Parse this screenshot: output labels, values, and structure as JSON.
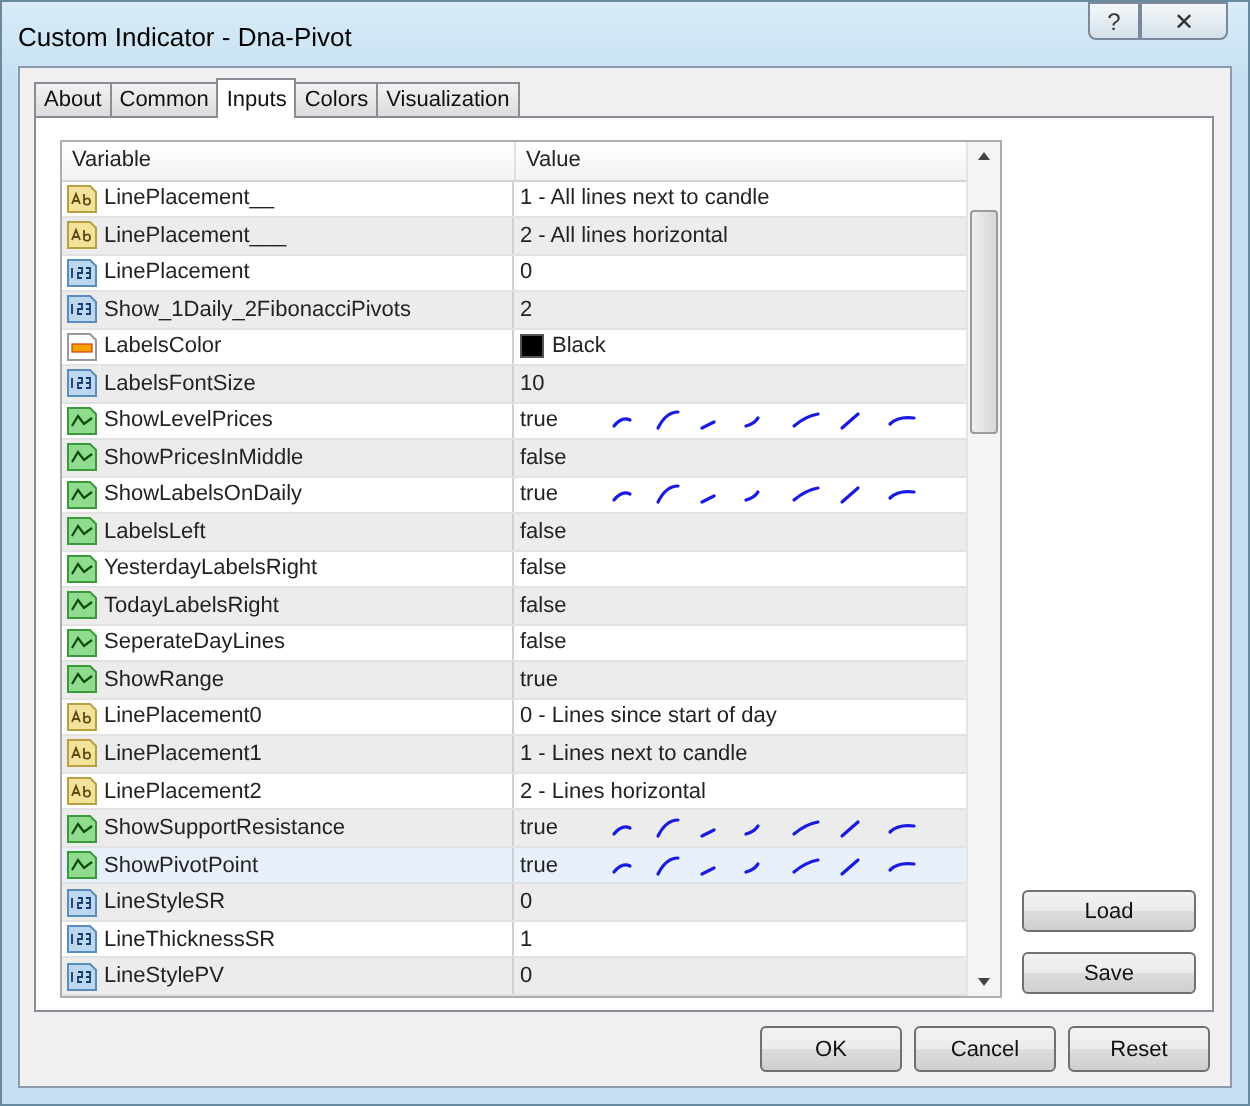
{
  "window": {
    "title": "Custom Indicator - Dna-Pivot",
    "help_button": "?",
    "close_button": "✕"
  },
  "tabs": [
    {
      "label": "About",
      "selected": false
    },
    {
      "label": "Common",
      "selected": false
    },
    {
      "label": "Inputs",
      "selected": true
    },
    {
      "label": "Colors",
      "selected": false
    },
    {
      "label": "Visualization",
      "selected": false
    }
  ],
  "table": {
    "columns": [
      "Variable",
      "Value"
    ],
    "rows": [
      {
        "kind": "string",
        "variable": "LinePlacement__",
        "value": "1 - All lines next to candle",
        "selected": false,
        "annotated": false
      },
      {
        "kind": "string",
        "variable": "LinePlacement___",
        "value": "2 - All lines horizontal",
        "selected": false,
        "annotated": false
      },
      {
        "kind": "int",
        "variable": "LinePlacement",
        "value": "0",
        "selected": false,
        "annotated": false
      },
      {
        "kind": "int",
        "variable": "Show_1Daily_2FibonacciPivots",
        "value": "2",
        "selected": false,
        "annotated": false
      },
      {
        "kind": "color",
        "variable": "LabelsColor",
        "value": "Black",
        "color": "#000000",
        "selected": false,
        "annotated": false
      },
      {
        "kind": "int",
        "variable": "LabelsFontSize",
        "value": "10",
        "selected": false,
        "annotated": false
      },
      {
        "kind": "bool",
        "variable": "ShowLevelPrices",
        "value": "true",
        "selected": false,
        "annotated": true
      },
      {
        "kind": "bool",
        "variable": "ShowPricesInMiddle",
        "value": "false",
        "selected": false,
        "annotated": false
      },
      {
        "kind": "bool",
        "variable": "ShowLabelsOnDaily",
        "value": "true",
        "selected": false,
        "annotated": true
      },
      {
        "kind": "bool",
        "variable": "LabelsLeft",
        "value": "false",
        "selected": false,
        "annotated": false
      },
      {
        "kind": "bool",
        "variable": "YesterdayLabelsRight",
        "value": "false",
        "selected": false,
        "annotated": false
      },
      {
        "kind": "bool",
        "variable": "TodayLabelsRight",
        "value": "false",
        "selected": false,
        "annotated": false
      },
      {
        "kind": "bool",
        "variable": "SeperateDayLines",
        "value": "false",
        "selected": false,
        "annotated": false
      },
      {
        "kind": "bool",
        "variable": "ShowRange",
        "value": "true",
        "selected": false,
        "annotated": false
      },
      {
        "kind": "string",
        "variable": "LinePlacement0",
        "value": "0 - Lines since start of day",
        "selected": false,
        "annotated": false
      },
      {
        "kind": "string",
        "variable": "LinePlacement1",
        "value": "1 - Lines next to candle",
        "selected": false,
        "annotated": false
      },
      {
        "kind": "string",
        "variable": "LinePlacement2",
        "value": "2 - Lines horizontal",
        "selected": false,
        "annotated": false
      },
      {
        "kind": "bool",
        "variable": "ShowSupportResistance",
        "value": "true",
        "selected": false,
        "annotated": true
      },
      {
        "kind": "bool",
        "variable": "ShowPivotPoint",
        "value": "true",
        "selected": true,
        "annotated": true
      },
      {
        "kind": "int",
        "variable": "LineStyleSR",
        "value": "0",
        "selected": false,
        "annotated": false
      },
      {
        "kind": "int",
        "variable": "LineThicknessSR",
        "value": "1",
        "selected": false,
        "annotated": false
      },
      {
        "kind": "int",
        "variable": "LineStylePV",
        "value": "0",
        "selected": false,
        "annotated": false
      }
    ]
  },
  "side_buttons": [
    "Load",
    "Save"
  ],
  "buttons": [
    "OK",
    "Cancel",
    "Reset"
  ]
}
